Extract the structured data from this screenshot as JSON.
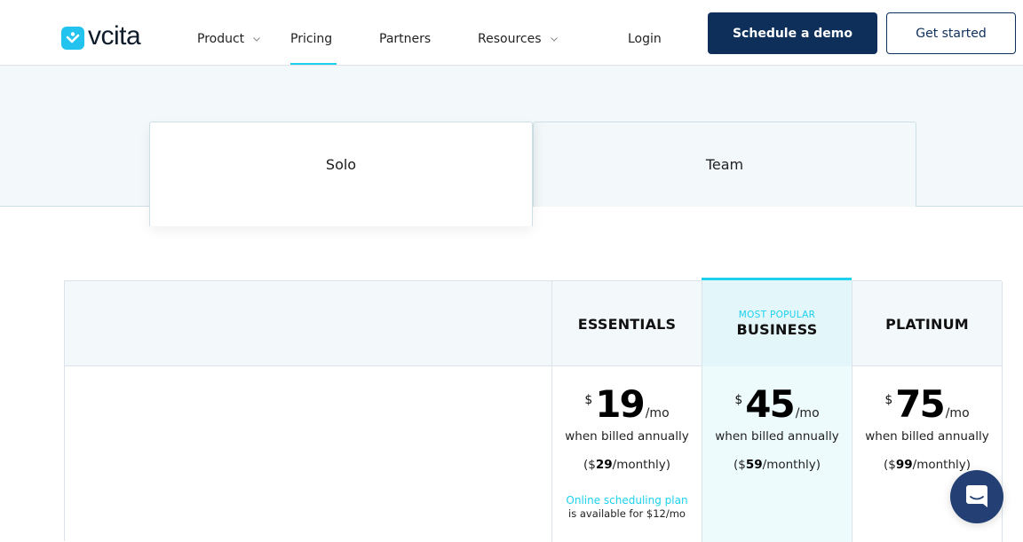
{
  "header": {
    "logo_text": "vcita",
    "nav": [
      {
        "label": "Product",
        "has_dropdown": true
      },
      {
        "label": "Pricing",
        "has_dropdown": false,
        "active": true
      },
      {
        "label": "Partners",
        "has_dropdown": false
      },
      {
        "label": "Resources",
        "has_dropdown": true
      }
    ],
    "login_label": "Login",
    "demo_button": "Schedule a demo",
    "start_button": "Get started"
  },
  "tabs": [
    {
      "label": "Solo",
      "active": true
    },
    {
      "label": "Team",
      "active": false
    }
  ],
  "plans": [
    {
      "name": "ESSENTIALS",
      "tag": "",
      "currency": "$",
      "price": "19",
      "per": "/mo",
      "billed": "when billed annually",
      "monthly_prefix": "($",
      "monthly_price": "29",
      "monthly_suffix": "/monthly)",
      "note_link": "Online scheduling plan",
      "note_text": "is available for $12/mo"
    },
    {
      "name": "BUSINESS",
      "tag": "MOST POPULAR",
      "currency": "$",
      "price": "45",
      "per": "/mo",
      "billed": "when billed annually",
      "monthly_prefix": "($",
      "monthly_price": "59",
      "monthly_suffix": "/monthly)"
    },
    {
      "name": "PLATINUM",
      "tag": "",
      "currency": "$",
      "price": "75",
      "per": "/mo",
      "billed": "when billed annually",
      "monthly_prefix": "($",
      "monthly_price": "99",
      "monthly_suffix": "/monthly)"
    }
  ],
  "colors": {
    "accent": "#1dd1ee",
    "brand_navy": "#0e2f5a",
    "chat_bg": "#233f73",
    "band_bg": "#f3f8fb"
  },
  "icons": {
    "logo": "vcita-logo-icon",
    "dropdown": "chevron-down-icon",
    "chat": "chat-bubble-icon"
  }
}
